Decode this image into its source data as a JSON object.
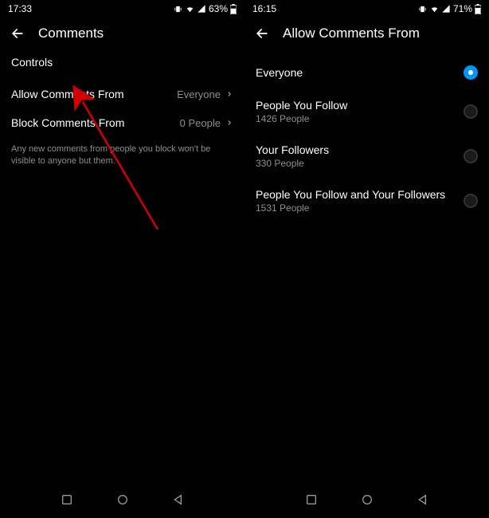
{
  "left": {
    "status": {
      "time": "17:33",
      "battery": "63%"
    },
    "title": "Comments",
    "section_label": "Controls",
    "rows": [
      {
        "label": "Allow Comments From",
        "value": "Everyone"
      },
      {
        "label": "Block Comments From",
        "value": "0 People"
      }
    ],
    "help_text": "Any new comments from people you block won't be visible to anyone but them."
  },
  "right": {
    "status": {
      "time": "16:15",
      "battery": "71%"
    },
    "title": "Allow Comments From",
    "options": [
      {
        "label": "Everyone",
        "sub": "",
        "selected": true
      },
      {
        "label": "People You Follow",
        "sub": "1426 People",
        "selected": false
      },
      {
        "label": "Your Followers",
        "sub": "330 People",
        "selected": false
      },
      {
        "label": "People You Follow and Your Followers",
        "sub": "1531 People",
        "selected": false
      }
    ]
  }
}
